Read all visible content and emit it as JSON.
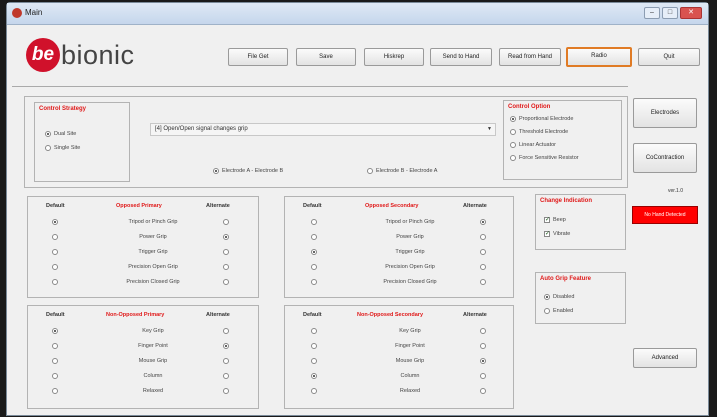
{
  "window": {
    "title": "Main",
    "buttons": {
      "minimize": "–",
      "maximize": "□",
      "close": "✕"
    }
  },
  "logo": {
    "be": "be",
    "rest": "bionic"
  },
  "toolbar": [
    {
      "key": "file-get",
      "label": "File Get"
    },
    {
      "key": "save",
      "label": "Save"
    },
    {
      "key": "hiskrep",
      "label": "Hiskrep"
    },
    {
      "key": "send-to-hand",
      "label": "Send to Hand"
    },
    {
      "key": "read-from-hand",
      "label": "Read from Hand"
    },
    {
      "key": "radio",
      "label": "Radio",
      "highlighted": true
    },
    {
      "key": "quit",
      "label": "Quit"
    }
  ],
  "control_strategy": {
    "title": "Control Strategy",
    "options": [
      {
        "label": "Dual Site",
        "selected": true
      },
      {
        "label": "Single Site",
        "selected": false
      }
    ]
  },
  "grip_dropdown": {
    "value": "[4] Open/Open signal changes grip"
  },
  "electrodes": [
    {
      "label": "Electrode A - Electrode B",
      "selected": true
    },
    {
      "label": "Electrode B - Electrode A",
      "selected": false
    }
  ],
  "control_option": {
    "title": "Control Option",
    "options": [
      {
        "label": "Proportional Electrode",
        "selected": true
      },
      {
        "label": "Threshold Electrode",
        "selected": false
      },
      {
        "label": "Linear Actuator",
        "selected": false
      },
      {
        "label": "Force Sensitive Resistor",
        "selected": false
      }
    ]
  },
  "side_buttons": {
    "electrodes": "Electrodes",
    "cocontraction": "CoContraction",
    "advanced": "Advanced"
  },
  "version": "ver.1.0",
  "status_box": "No Hand Detected",
  "change_indication": {
    "title": "Change Indication",
    "options": [
      {
        "label": "Beep",
        "checked": true
      },
      {
        "label": "Vibrate",
        "checked": true
      }
    ]
  },
  "auto_grip": {
    "title": "Auto Grip Feature",
    "options": [
      {
        "label": "Disabled",
        "selected": true
      },
      {
        "label": "Enabled",
        "selected": false
      }
    ]
  },
  "grip_panels": [
    {
      "title": "Opposed Primary",
      "default_header": "Default",
      "alternate_header": "Alternate",
      "rows": [
        {
          "label": "Tripod or Pinch Grip",
          "default": true,
          "alternate": false
        },
        {
          "label": "Power Grip",
          "default": false,
          "alternate": true
        },
        {
          "label": "Trigger Grip",
          "default": false,
          "alternate": false
        },
        {
          "label": "Precision Open Grip",
          "default": false,
          "alternate": false
        },
        {
          "label": "Precision Closed Grip",
          "default": false,
          "alternate": false
        }
      ]
    },
    {
      "title": "Opposed Secondary",
      "default_header": "Default",
      "alternate_header": "Alternate",
      "rows": [
        {
          "label": "Tripod or Pinch Grip",
          "default": false,
          "alternate": true
        },
        {
          "label": "Power Grip",
          "default": false,
          "alternate": false
        },
        {
          "label": "Trigger Grip",
          "default": true,
          "alternate": false
        },
        {
          "label": "Precision Open Grip",
          "default": false,
          "alternate": false
        },
        {
          "label": "Precision Closed Grip",
          "default": false,
          "alternate": false
        }
      ]
    },
    {
      "title": "Non-Opposed Primary",
      "default_header": "Default",
      "alternate_header": "Alternate",
      "rows": [
        {
          "label": "Key Grip",
          "default": true,
          "alternate": false
        },
        {
          "label": "Finger Point",
          "default": false,
          "alternate": true
        },
        {
          "label": "Mouse Grip",
          "default": false,
          "alternate": false
        },
        {
          "label": "Column",
          "default": false,
          "alternate": false
        },
        {
          "label": "Relaxed",
          "default": false,
          "alternate": false
        }
      ]
    },
    {
      "title": "Non-Opposed Secondary",
      "default_header": "Default",
      "alternate_header": "Alternate",
      "rows": [
        {
          "label": "Key Grip",
          "default": false,
          "alternate": false
        },
        {
          "label": "Finger Point",
          "default": false,
          "alternate": false
        },
        {
          "label": "Mouse Grip",
          "default": false,
          "alternate": true
        },
        {
          "label": "Column",
          "default": true,
          "alternate": false
        },
        {
          "label": "Relaxed",
          "default": false,
          "alternate": false
        }
      ]
    }
  ]
}
